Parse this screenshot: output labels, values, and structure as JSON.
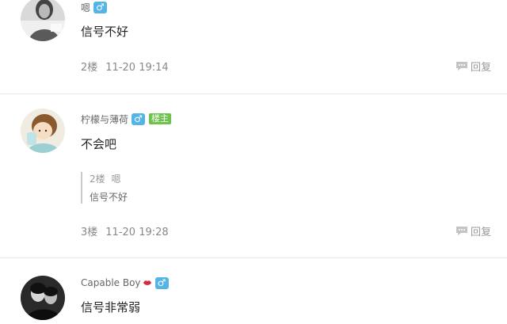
{
  "posts": [
    {
      "username": "嗯",
      "gender": "♂",
      "content": "信号不好",
      "floor": "2楼",
      "time": "11-20 19:14",
      "reply_label": "回复"
    },
    {
      "username": "柠檬与薄荷",
      "gender": "♂",
      "badge": "楼主",
      "content": "不会吧",
      "quote": {
        "floor": "2楼",
        "user": "嗯",
        "text": "信号不好"
      },
      "floor": "3楼",
      "time": "11-20 19:28",
      "reply_label": "回复"
    },
    {
      "username": "Capable Boy",
      "gender": "♂",
      "content": "信号非常弱"
    }
  ],
  "colors": {
    "gender_badge": "#54b4e6",
    "owner_badge": "#6cc24a",
    "divider": "#e8e8e8"
  },
  "icons": [
    "male-icon",
    "speech-bubble-icon",
    "lips-icon"
  ]
}
